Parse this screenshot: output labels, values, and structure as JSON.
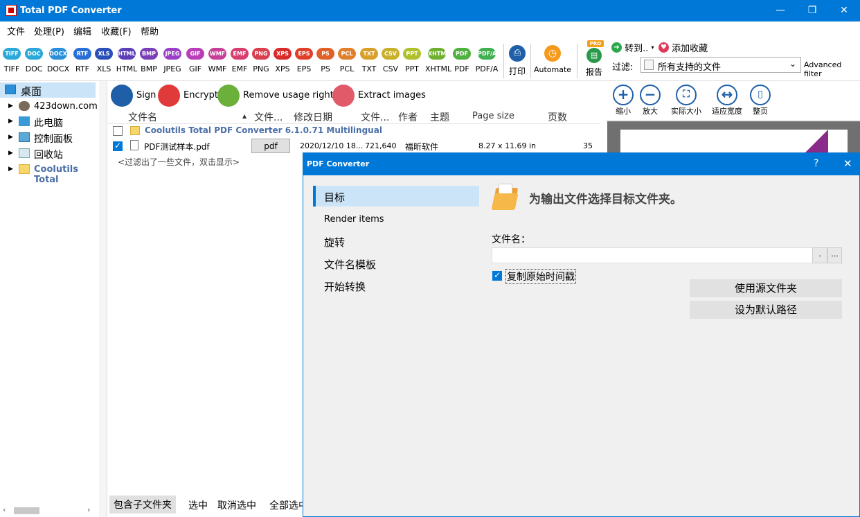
{
  "app": {
    "title": "Total PDF Converter"
  },
  "window": {
    "minimize": "—",
    "restore": "❐",
    "close": "✕"
  },
  "menu": [
    "文件",
    "处理(P)",
    "编辑",
    "收藏(F)",
    "帮助"
  ],
  "formats": [
    {
      "label": "TIFF",
      "color": "#2aa8d8"
    },
    {
      "label": "DOC",
      "color": "#2aa8d8"
    },
    {
      "label": "DOCX",
      "color": "#2a8fd8"
    },
    {
      "label": "RTF",
      "color": "#2a6fd8"
    },
    {
      "label": "XLS",
      "color": "#2a4fb8"
    },
    {
      "label": "HTML",
      "color": "#5a3fb8"
    },
    {
      "label": "BMP",
      "color": "#7a3fb8"
    },
    {
      "label": "JPEG",
      "color": "#9a3fc8"
    },
    {
      "label": "GIF",
      "color": "#b83fb8"
    },
    {
      "label": "WMF",
      "color": "#c83f98"
    },
    {
      "label": "EMF",
      "color": "#d83f6f"
    },
    {
      "label": "PNG",
      "color": "#d83f4f"
    },
    {
      "label": "XPS",
      "color": "#d82a2a"
    },
    {
      "label": "EPS",
      "color": "#e0402a"
    },
    {
      "label": "PS",
      "color": "#e0602a"
    },
    {
      "label": "PCL",
      "color": "#e0802a"
    },
    {
      "label": "TXT",
      "color": "#d8a02a"
    },
    {
      "label": "CSV",
      "color": "#c8b02a"
    },
    {
      "label": "PPT",
      "color": "#b0c02a"
    },
    {
      "label": "XHTML",
      "color": "#70b030"
    },
    {
      "label": "PDF",
      "color": "#50b040"
    },
    {
      "label": "PDF/A",
      "color": "#40b050"
    }
  ],
  "toolbar": {
    "print": "打印",
    "automate": "Automate",
    "report": "报告",
    "pro": "PRO",
    "goto": "转到..",
    "add_favorite": "添加收藏",
    "filter_label": "过滤:",
    "filter_value": "所有支持的文件",
    "advanced_filter": "Advanced filter"
  },
  "tree": [
    {
      "label": "桌面"
    },
    {
      "label": "423down.com"
    },
    {
      "label": "此电脑"
    },
    {
      "label": "控制面板"
    },
    {
      "label": "回收站"
    },
    {
      "label": "Coolutils Total"
    }
  ],
  "actions": {
    "sign": "Sign",
    "encrypt": "Encrypt",
    "remove_rights": "Remove usage rights",
    "extract_images": "Extract images"
  },
  "columns": {
    "name": "文件名",
    "type": "文件...",
    "modified": "修改日期",
    "size": "文件...",
    "author": "作者",
    "subject": "主题",
    "pagesize": "Page size",
    "pages": "页数"
  },
  "folder_row": {
    "name": "Coolutils Total PDF Converter 6.1.0.71 Multilingual"
  },
  "file_row": {
    "name": "PDF测试样本.pdf",
    "type": "pdf",
    "modified": "2020/12/10 18...",
    "size": "721,640",
    "author": "福昕软件",
    "pagesize": "8.27 x 11.69 in",
    "pages": "35"
  },
  "filtered_hint": "<过滤出了一些文件，双击显示>",
  "bottom": {
    "include_sub": "包含子文件夹",
    "select": "选中",
    "deselect": "取消选中",
    "select_all": "全部选中"
  },
  "preview": {
    "zoom_out": "缩小",
    "zoom_in": "放大",
    "actual": "实际大小",
    "fit_width": "适应宽度",
    "full_page": "整页"
  },
  "dialog": {
    "title": "PDF Converter",
    "help": "?",
    "close": "✕",
    "nav": [
      "目标",
      "Render items",
      "旋转",
      "文件名模板",
      "开始转换"
    ],
    "heading": "为输出文件选择目标文件夹。",
    "filename_label": "文件名：",
    "filename_value": "",
    "browse": "...",
    "keep_timestamp": "复制原始时间戳",
    "use_source": "使用源文件夹",
    "set_default": "设为默认路径"
  }
}
